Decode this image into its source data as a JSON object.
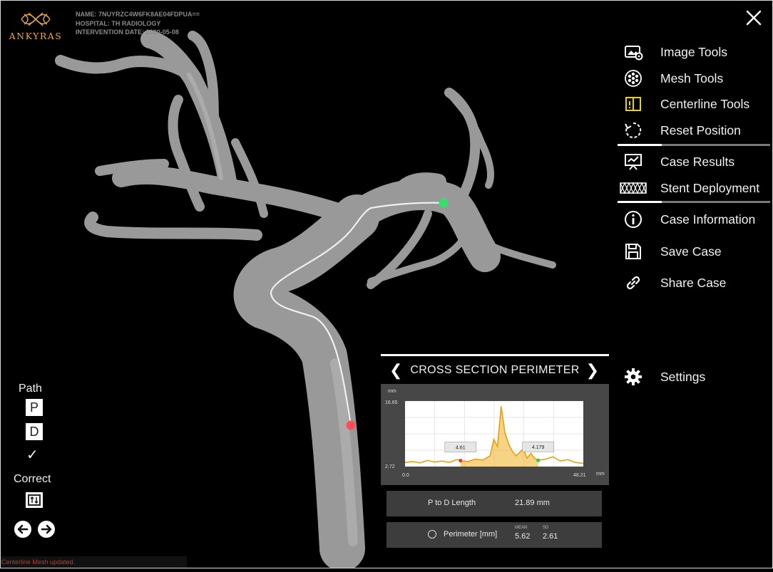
{
  "app": {
    "logo_text": "ANKYRAS",
    "close_icon": "close-icon"
  },
  "case_meta": {
    "name": "NAME: 7NUYRZC4W6FK8AE04FDPUA==",
    "hospital": "HOSPITAL: TH RADIOLOGY",
    "intervention_date": "INTERVENTION DATE: 2020-05-08"
  },
  "menu": {
    "items": [
      {
        "label": "Image Tools",
        "icon": "image-tools-icon"
      },
      {
        "label": "Mesh Tools",
        "icon": "mesh-icon"
      },
      {
        "label": "Centerline Tools",
        "icon": "centerline-icon"
      },
      {
        "label": "Reset Position",
        "icon": "reset-icon"
      },
      {
        "label": "Case Results",
        "icon": "presentation-icon"
      },
      {
        "label": "Stent Deployment",
        "icon": "stent-icon"
      },
      {
        "label": "Case Information",
        "icon": "info-icon"
      },
      {
        "label": "Save Case",
        "icon": "save-icon"
      },
      {
        "label": "Share Case",
        "icon": "link-icon"
      },
      {
        "label": "Settings",
        "icon": "gear-icon"
      }
    ]
  },
  "path_tools": {
    "path_label": "Path",
    "p_label": "P",
    "d_label": "D",
    "check_glyph": "✓",
    "correct_label": "Correct"
  },
  "status": {
    "message": "Centerline Mesh updated."
  },
  "panel": {
    "title": "CROSS SECTION PERIMETER",
    "prev_glyph": "❮",
    "next_glyph": "❯",
    "p_to_d_label": "P to D Length",
    "p_to_d_value": "21.89 mm",
    "perimeter_label": "Perimeter [mm]",
    "mean_label": "MEAN",
    "mean_value": "5.62",
    "sd_label": "SD",
    "sd_value": "2.61"
  },
  "chart_data": {
    "type": "area",
    "ylabel": "mm",
    "xlabel": "mm",
    "xlim": [
      0.0,
      48.21
    ],
    "ylim": [
      2.72,
      16.65
    ],
    "x_tick_labels": [
      "0.0",
      "48.21"
    ],
    "y_tick_labels": [
      "2.72",
      "16.65"
    ],
    "line_color": "#f0b020",
    "highlight_range": [
      15.0,
      36.0
    ],
    "proximal_marker": {
      "x": 15.0,
      "y": 4.0,
      "label": "4.61",
      "color": "#e53935"
    },
    "distal_marker": {
      "x": 36.0,
      "y": 4.05,
      "label": "4.179",
      "color": "#2ecc40"
    },
    "x": [
      0,
      2,
      4,
      6,
      8,
      10,
      12,
      14,
      15,
      17,
      19,
      21,
      23,
      24,
      25,
      26,
      27,
      28,
      29,
      30,
      32,
      33,
      34,
      35,
      36,
      38,
      40,
      42,
      44,
      46,
      48.21
    ],
    "y": [
      3.6,
      3.8,
      3.5,
      4.0,
      3.7,
      3.9,
      3.6,
      4.2,
      4.0,
      3.8,
      4.3,
      4.1,
      5.0,
      8.5,
      7.0,
      15.5,
      10.0,
      7.5,
      6.0,
      5.0,
      6.5,
      4.5,
      5.5,
      4.5,
      4.05,
      4.3,
      4.8,
      3.9,
      4.2,
      3.6,
      3.4
    ]
  }
}
